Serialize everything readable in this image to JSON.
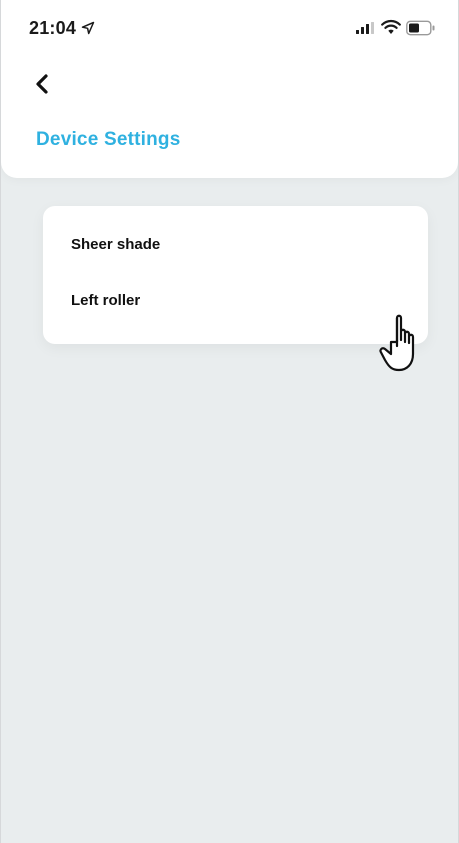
{
  "status_bar": {
    "time": "21:04",
    "icons": [
      "location-arrow-icon",
      "cellular-signal-icon",
      "wifi-icon",
      "battery-icon"
    ]
  },
  "header": {
    "back_icon": "chevron-left-icon",
    "title": "Device Settings"
  },
  "devices": [
    {
      "label": "Sheer shade"
    },
    {
      "label": "Left roller"
    }
  ],
  "colors": {
    "accent": "#2fb1e0",
    "background": "#e9edee",
    "card": "#ffffff",
    "text": "#111111"
  },
  "cursor": "hand-pointer-icon"
}
